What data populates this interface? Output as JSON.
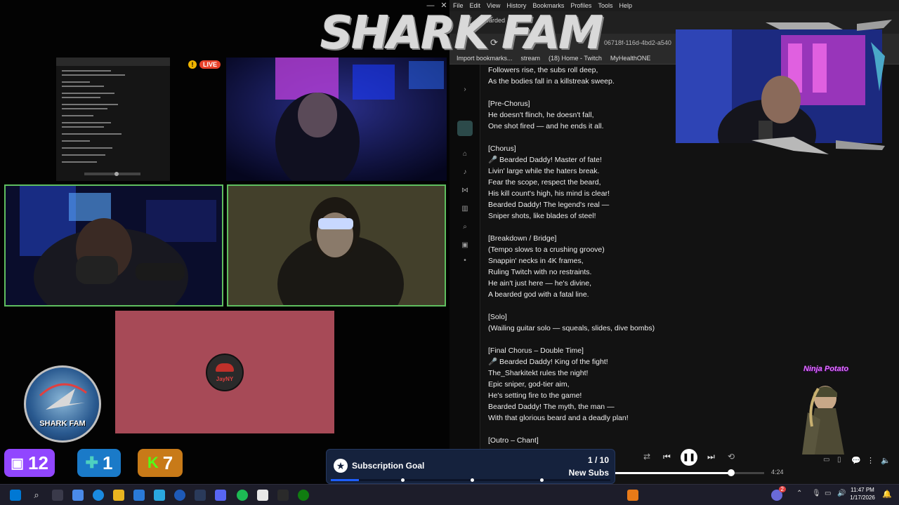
{
  "overlay": {
    "logo_title": "SHARK FAM",
    "bottom_logo_text": "SHARK FAM",
    "corner_character_text": "Ninja Potato"
  },
  "discord": {
    "live_badge": "LIVE",
    "warning_glyph": "!",
    "avatar_name": "JayNY",
    "win_buttons": [
      "—",
      "☐",
      "✕"
    ]
  },
  "counters": {
    "twitch": "12",
    "kickish": "1",
    "kick": "7"
  },
  "browser": {
    "menu": [
      "File",
      "Edit",
      "View",
      "History",
      "Bookmarks",
      "Profiles",
      "Tools",
      "Help"
    ],
    "tab_label": "Bearded",
    "url_fragment": "06718f-116d-4bd2-a540",
    "bookmarks": [
      "Import bookmarks...",
      "stream",
      "(18) Home - Twitch",
      "MyHealthONE"
    ]
  },
  "lyrics": [
    "Followers rise, the subs roll deep,",
    "As the bodies fall in a killstreak sweep.",
    "",
    "[Pre-Chorus]",
    "He doesn't flinch, he doesn't fall,",
    "One shot fired — and he ends it all.",
    "",
    "[Chorus]",
    "🎤 Bearded Daddy! Master of fate!",
    "Livin' large while the haters break.",
    "Fear the scope, respect the beard,",
    "His kill count's high, his mind is clear!",
    "Bearded Daddy! The legend's real —",
    "Sniper shots, like blades of steel!",
    "",
    "[Breakdown / Bridge]",
    "(Tempo slows to a crushing groove)",
    "Snappin' necks in 4K frames,",
    "Ruling Twitch with no restraints.",
    "He ain't just here — he's divine,",
    "A bearded god with a fatal line.",
    "",
    "[Solo]",
    "(Wailing guitar solo — squeals, slides, dive bombs)",
    "",
    "[Final Chorus – Double Time]",
    "🎤 Bearded Daddy! King of the fight!",
    "The_Sharkitekt rules the night!",
    "Epic sniper, god-tier aim,",
    "He's setting fire to the game!",
    "Bearded Daddy! The myth, the man —",
    "With that glorious beard and a deadly plan!",
    "",
    "[Outro – Chant]"
  ],
  "player": {
    "duration": "4:24",
    "progress": 0.78
  },
  "goal": {
    "title": "Subscription Goal",
    "count": "1 / 10",
    "label": "New Subs",
    "progress": 0.1
  },
  "taskbar": {
    "time": "11:47 PM",
    "date": "1/17/2026",
    "notif_count": "2"
  },
  "colors": {
    "twitch": "#9146ff",
    "kick": "#53fc18",
    "goal_bg": "#15223d",
    "speaking_border": "#5fbf5f",
    "live_red": "#e8412a"
  }
}
